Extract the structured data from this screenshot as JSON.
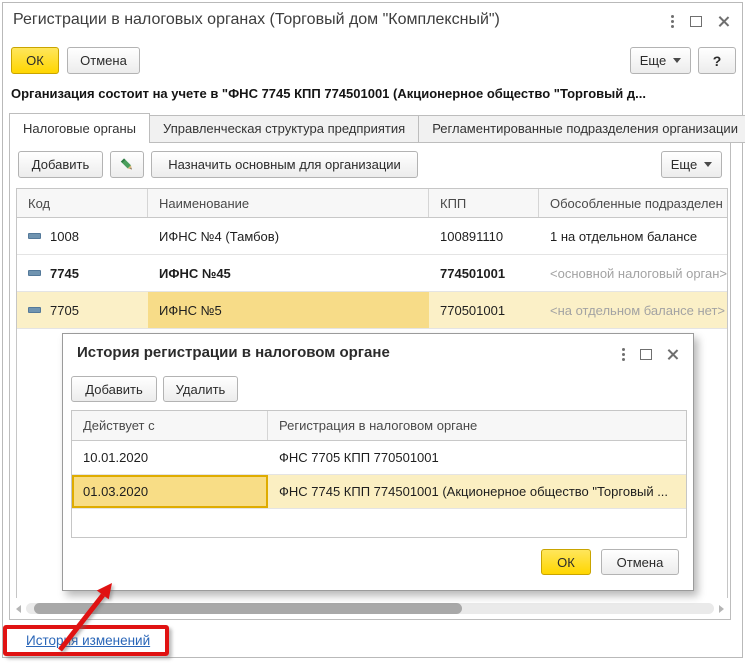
{
  "main_window": {
    "title": "Регистрации в налоговых органах (Торговый дом \"Комплексный\")",
    "buttons": {
      "ok": "ОК",
      "cancel": "Отмена",
      "more": "Еще",
      "help": "?"
    },
    "info_text": "Организация состоит на учете в \"ФНС 7745 КПП 774501001 (Акционерное общество \"Торговый д...",
    "tabs": [
      {
        "label": "Налоговые органы",
        "active": true
      },
      {
        "label": "Управленческая структура предприятия",
        "active": false
      },
      {
        "label": "Регламентированные подразделения организации",
        "active": false
      }
    ],
    "toolbar": {
      "add": "Добавить",
      "assign_main": "Назначить основным для организации",
      "more": "Еще"
    },
    "table": {
      "columns": [
        "Код",
        "Наименование",
        "КПП",
        "Обособленные подразделен"
      ],
      "rows": [
        {
          "code": "1008",
          "name": "ИФНС №4 (Тамбов)",
          "kpp": "100891110",
          "subdivisions": "1 на отдельном балансе"
        },
        {
          "code": "7745",
          "name": "ИФНС №45",
          "kpp": "774501001",
          "subdivisions": "<основной налоговый орган>"
        },
        {
          "code": "7705",
          "name": "ИФНС №5",
          "kpp": "770501001",
          "subdivisions": "<на отдельном балансе нет>"
        }
      ]
    },
    "history_link": "История изменений"
  },
  "dialog": {
    "title": "История регистрации в налоговом органе",
    "buttons": {
      "add": "Добавить",
      "delete": "Удалить",
      "ok": "ОК",
      "cancel": "Отмена"
    },
    "table": {
      "columns": [
        "Действует с",
        "Регистрация в налоговом органе"
      ],
      "rows": [
        {
          "date": "10.01.2020",
          "registration": "ФНС 7705 КПП 770501001"
        },
        {
          "date": "01.03.2020",
          "registration": "ФНС 7745 КПП 774501001 (Акционерное общество \"Торговый ..."
        }
      ]
    }
  },
  "icons": {
    "window_menu": "kebab-dots",
    "window_maximize": "square-outline",
    "window_close": "x-cross",
    "edit": "green-pencil",
    "dropdown": "down-triangle",
    "row_marker": "blue-dash",
    "scroll_left": "left-triangle",
    "scroll_right": "right-triangle"
  },
  "colors": {
    "accent_yellow": "#FFD600",
    "selection_row": "#FBF0C7",
    "selection_cell": "#F7DC88",
    "selection_border": "#DFAC00",
    "muted_text": "#A3A3A3",
    "link": "#2A66B8",
    "annotation_red": "#E01212",
    "marker_blue": "#7094B0"
  }
}
